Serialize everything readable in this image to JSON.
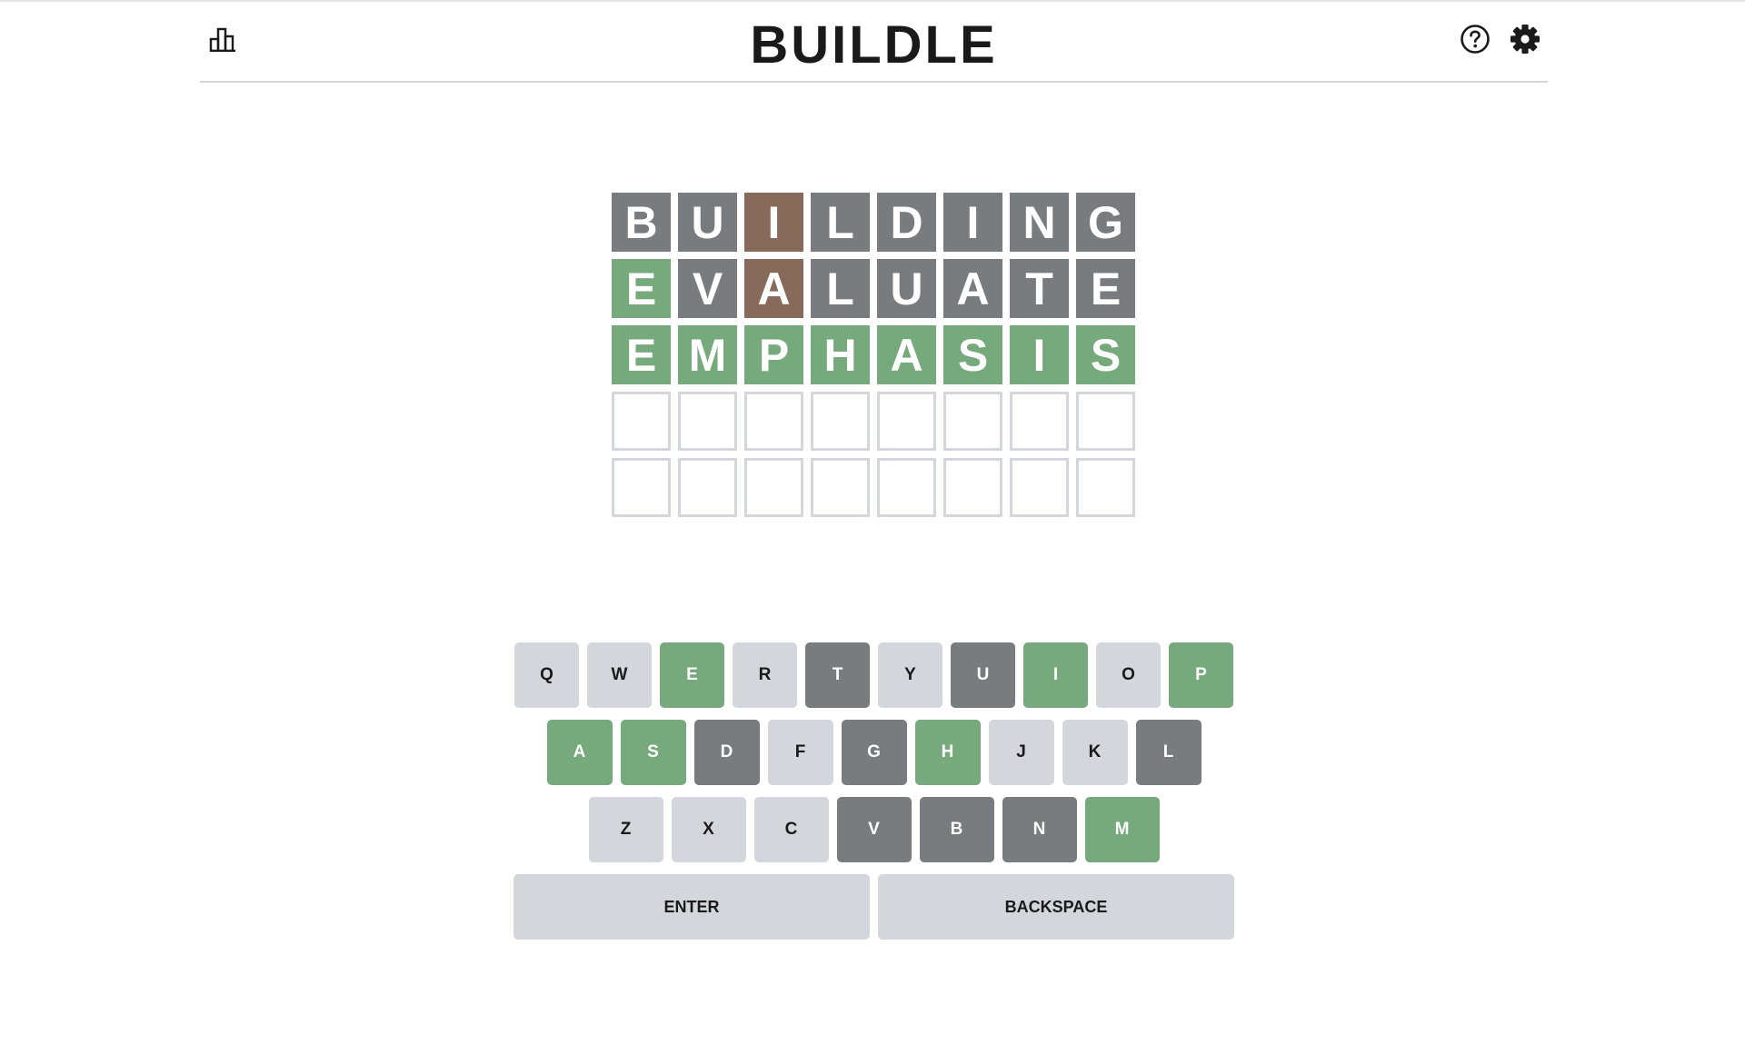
{
  "app": {
    "title": "BUILDLE"
  },
  "header": {
    "stats_icon": "bar-chart-icon",
    "help_icon": "question-circle-icon",
    "settings_icon": "gear-icon"
  },
  "colors": {
    "correct": "#76a97b",
    "present": "#876a5a",
    "absent": "#787c7f",
    "empty_border": "#d3d6da",
    "key_default": "#d3d6da"
  },
  "board": {
    "rows": [
      {
        "letters": [
          "B",
          "U",
          "I",
          "L",
          "D",
          "I",
          "N",
          "G"
        ],
        "states": [
          "absent",
          "absent",
          "present",
          "absent",
          "absent",
          "absent",
          "absent",
          "absent"
        ]
      },
      {
        "letters": [
          "E",
          "V",
          "A",
          "L",
          "U",
          "A",
          "T",
          "E"
        ],
        "states": [
          "correct",
          "absent",
          "present",
          "absent",
          "absent",
          "absent",
          "absent",
          "absent"
        ]
      },
      {
        "letters": [
          "E",
          "M",
          "P",
          "H",
          "A",
          "S",
          "I",
          "S"
        ],
        "states": [
          "correct",
          "correct",
          "correct",
          "correct",
          "correct",
          "correct",
          "correct",
          "correct"
        ]
      },
      {
        "letters": [
          "",
          "",
          "",
          "",
          "",
          "",
          "",
          ""
        ],
        "states": [
          "empty",
          "empty",
          "empty",
          "empty",
          "empty",
          "empty",
          "empty",
          "empty"
        ]
      },
      {
        "letters": [
          "",
          "",
          "",
          "",
          "",
          "",
          "",
          ""
        ],
        "states": [
          "empty",
          "empty",
          "empty",
          "empty",
          "empty",
          "empty",
          "empty",
          "empty"
        ]
      }
    ]
  },
  "keyboard": {
    "rows": [
      [
        {
          "label": "Q",
          "state": "default"
        },
        {
          "label": "W",
          "state": "default"
        },
        {
          "label": "E",
          "state": "correct"
        },
        {
          "label": "R",
          "state": "default"
        },
        {
          "label": "T",
          "state": "absent"
        },
        {
          "label": "Y",
          "state": "default"
        },
        {
          "label": "U",
          "state": "absent"
        },
        {
          "label": "I",
          "state": "correct"
        },
        {
          "label": "O",
          "state": "default"
        },
        {
          "label": "P",
          "state": "correct"
        }
      ],
      [
        {
          "label": "A",
          "state": "correct"
        },
        {
          "label": "S",
          "state": "correct"
        },
        {
          "label": "D",
          "state": "absent"
        },
        {
          "label": "F",
          "state": "default"
        },
        {
          "label": "G",
          "state": "absent"
        },
        {
          "label": "H",
          "state": "correct"
        },
        {
          "label": "J",
          "state": "default"
        },
        {
          "label": "K",
          "state": "default"
        },
        {
          "label": "L",
          "state": "absent"
        }
      ],
      [
        {
          "label": "Z",
          "state": "default"
        },
        {
          "label": "X",
          "state": "default"
        },
        {
          "label": "C",
          "state": "default"
        },
        {
          "label": "V",
          "state": "absent"
        },
        {
          "label": "B",
          "state": "absent"
        },
        {
          "label": "N",
          "state": "absent"
        },
        {
          "label": "M",
          "state": "correct"
        }
      ]
    ],
    "enter_label": "ENTER",
    "backspace_label": "BACKSPACE"
  }
}
